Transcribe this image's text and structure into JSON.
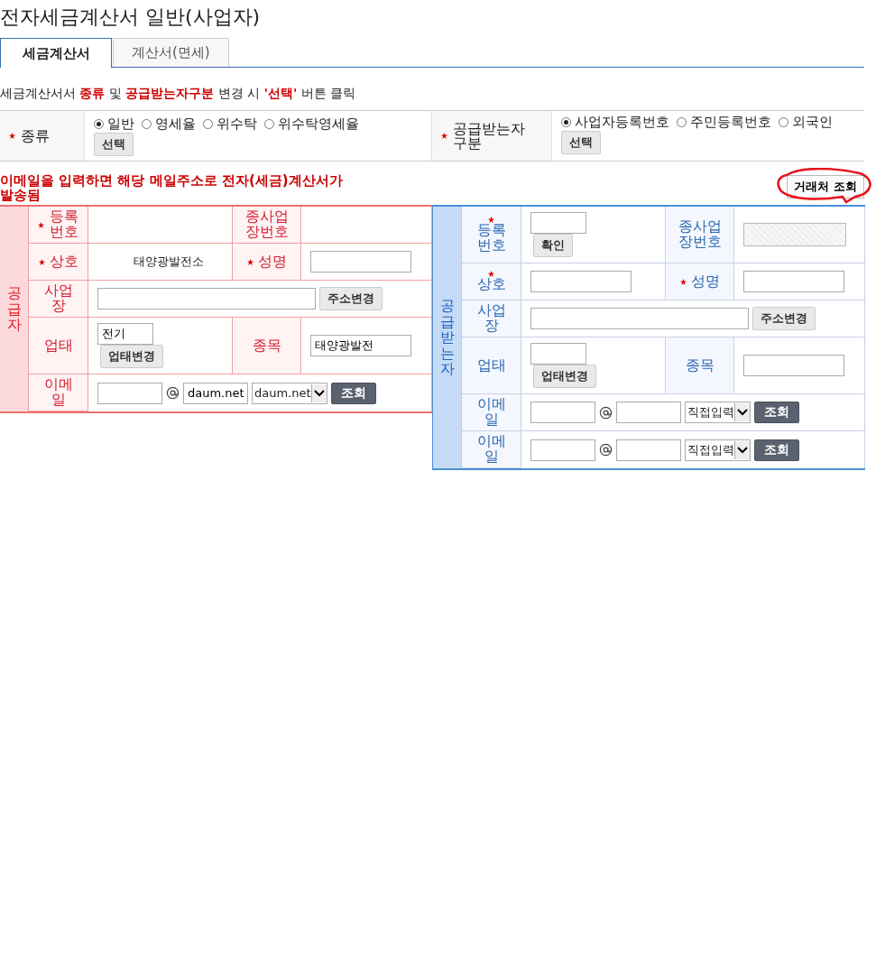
{
  "title": "전자세금계산서 일반(사업자)",
  "tabs": [
    {
      "label": "세금계산서",
      "selected": true
    },
    {
      "label": "계산서(면세)",
      "selected": false
    }
  ],
  "instruction": [
    {
      "text": "세금계산서서 ",
      "emphasis": false
    },
    {
      "text": "종류",
      "emphasis": true
    },
    {
      "text": " 및 ",
      "emphasis": false
    },
    {
      "text": "공급받는자구분",
      "emphasis": true
    },
    {
      "text": " 변경 시 ",
      "emphasis": false
    },
    {
      "text": "'선택'",
      "emphasis": true
    },
    {
      "text": " 버튼 클릭",
      "emphasis": false
    }
  ],
  "selection": [
    {
      "label": "종류",
      "required": true,
      "button": "선택",
      "options": [
        {
          "label": "일반",
          "selected": true
        },
        {
          "label": "영세율",
          "selected": false
        },
        {
          "label": "위수탁",
          "selected": false
        },
        {
          "label": "위수탁영세율",
          "selected": false
        }
      ]
    },
    {
      "label": "공급받는자구분",
      "required": true,
      "button": "선택",
      "options": [
        {
          "label": "사업자등록번호",
          "selected": true
        },
        {
          "label": "주민등록번호",
          "selected": false
        },
        {
          "label": "외국인",
          "selected": false
        }
      ]
    }
  ],
  "email_notice": "이메일을 입력하면 해당 메일주소로 전자(세금)계산서가 발송됨",
  "lookup_button": {
    "label": "거래처 조회",
    "annotated": true
  },
  "parties": [
    {
      "kind": "supplier",
      "side_label": "공급자",
      "rows": [
        {
          "fields": [
            {
              "label": "등록번호",
              "required": true,
              "star_above": false,
              "control": {
                "kind": "text"
              }
            },
            {
              "label": "종사업장번호",
              "required": false,
              "control": {
                "kind": "text"
              }
            }
          ]
        },
        {
          "fields": [
            {
              "label": "상호",
              "required": true,
              "star_above": false,
              "control": {
                "kind": "text",
                "value": "태양광발전소"
              }
            },
            {
              "label": "성명",
              "required": true,
              "star_above": false,
              "control": {
                "kind": "input"
              }
            }
          ]
        },
        {
          "fields": [
            {
              "label": "사업장",
              "required": false,
              "control": {
                "kind": "address",
                "button": "주소변경"
              }
            }
          ]
        },
        {
          "fields": [
            {
              "label": "업태",
              "required": false,
              "control": {
                "kind": "input_button",
                "value": "전기",
                "button": "업태변경"
              }
            },
            {
              "label": "종목",
              "required": false,
              "control": {
                "kind": "input",
                "value": "태양광발전"
              }
            }
          ]
        },
        {
          "fields": [
            {
              "label": "이메일",
              "required": false,
              "control": {
                "kind": "email",
                "domain": "daum.net",
                "select": "daum.net",
                "button": "조회"
              }
            }
          ]
        }
      ]
    },
    {
      "kind": "buyer",
      "side_label": "공급받는자",
      "rows": [
        {
          "fields": [
            {
              "label": "등록번호",
              "required": true,
              "star_above": true,
              "control": {
                "kind": "input_button",
                "button": "확인"
              }
            },
            {
              "label": "종사업장번호",
              "required": false,
              "control": {
                "kind": "disabled"
              }
            }
          ]
        },
        {
          "fields": [
            {
              "label": "상호",
              "required": true,
              "star_above": true,
              "control": {
                "kind": "input"
              }
            },
            {
              "label": "성명",
              "required": true,
              "star_above": false,
              "control": {
                "kind": "input"
              }
            }
          ]
        },
        {
          "fields": [
            {
              "label": "사업장",
              "required": false,
              "control": {
                "kind": "address",
                "button": "주소변경"
              }
            }
          ]
        },
        {
          "fields": [
            {
              "label": "업태",
              "required": false,
              "control": {
                "kind": "input_button",
                "button": "업태변경"
              }
            },
            {
              "label": "종목",
              "required": false,
              "control": {
                "kind": "input"
              }
            }
          ]
        },
        {
          "fields": [
            {
              "label": "이메일",
              "required": false,
              "control": {
                "kind": "email",
                "select": "직접입력",
                "button": "조회"
              }
            }
          ]
        },
        {
          "fields": [
            {
              "label": "이메일",
              "required": false,
              "control": {
                "kind": "email",
                "select": "직접입력",
                "button": "조회"
              }
            }
          ]
        }
      ]
    }
  ]
}
